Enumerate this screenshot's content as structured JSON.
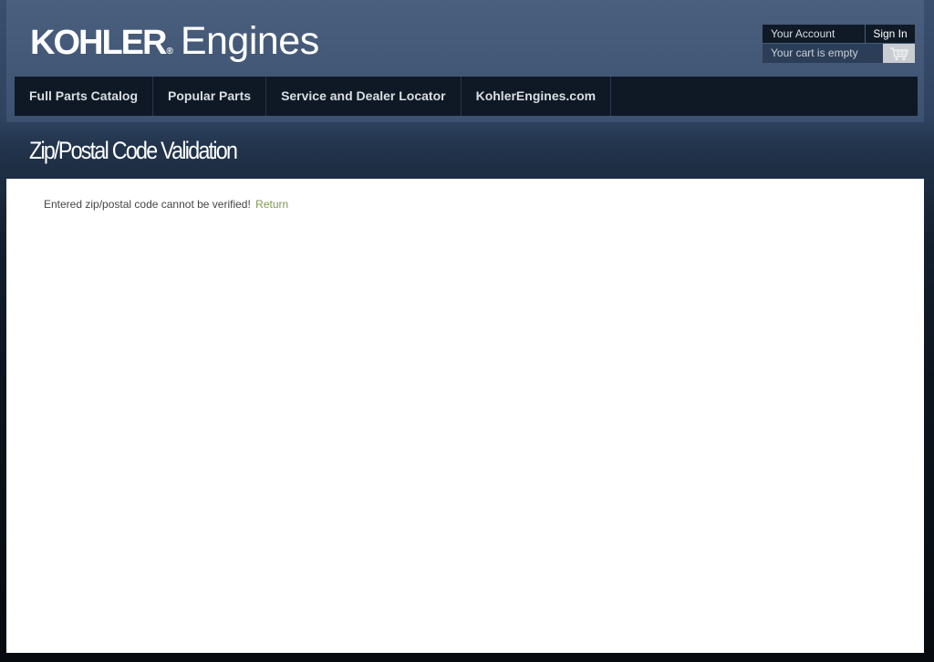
{
  "logo": {
    "brand": "KOHLER",
    "registered": "®",
    "product": "Engines"
  },
  "account": {
    "your_account": "Your Account",
    "sign_in": "Sign In",
    "cart_status": "Your cart is empty",
    "cart_icon": "shopping-cart-icon"
  },
  "nav": {
    "items": [
      {
        "label": "Full Parts Catalog"
      },
      {
        "label": "Popular Parts"
      },
      {
        "label": "Service and Dealer Locator"
      },
      {
        "label": "KohlerEngines.com"
      }
    ]
  },
  "page": {
    "title": "Zip/Postal Code Validation"
  },
  "content": {
    "message": "Entered zip/postal code cannot be verified!",
    "return_label": "Return"
  },
  "colors": {
    "link": "#7c9a52",
    "nav_background": "#0e1925",
    "header_background": "#435877"
  }
}
